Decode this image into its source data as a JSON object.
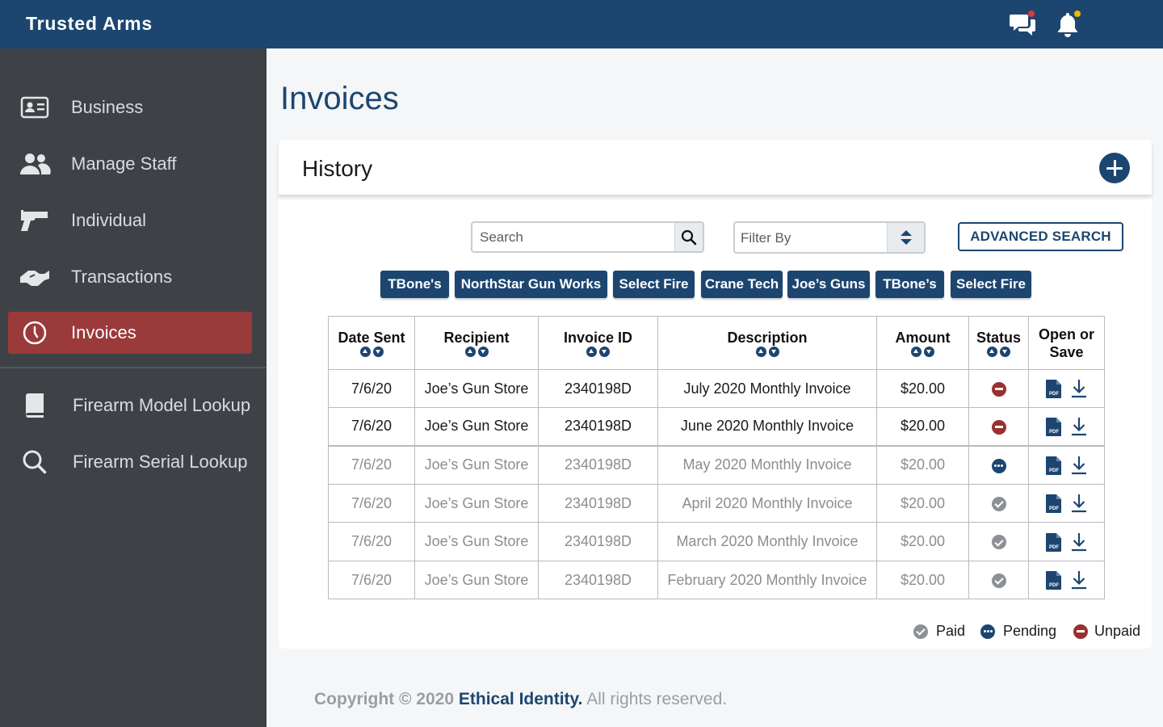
{
  "app": {
    "brand": "Trusted Arms"
  },
  "header": {
    "icons": [
      "chat-icon",
      "bell-icon"
    ]
  },
  "sidebar": {
    "items": [
      {
        "label": "Business",
        "icon": "id-card-icon"
      },
      {
        "label": "Manage Staff",
        "icon": "users-icon"
      },
      {
        "label": "Individual",
        "icon": "pistol-icon"
      },
      {
        "label": "Transactions",
        "icon": "handshake-icon"
      },
      {
        "label": "Invoices",
        "icon": "clock-icon",
        "active": true
      },
      {
        "label": "Firearm Model Lookup",
        "icon": "book-icon"
      },
      {
        "label": "Firearm Serial Lookup",
        "icon": "search-icon"
      }
    ]
  },
  "page": {
    "title": "Invoices"
  },
  "history": {
    "title": "History",
    "search_placeholder": "Search",
    "filter_label": "Filter By",
    "advanced_search": "ADVANCED SEARCH",
    "chips": [
      "TBone's",
      "NorthStar Gun Works",
      "Select Fire",
      "Crane Tech",
      "Joe’s Guns",
      "TBone’s",
      "Select Fire"
    ]
  },
  "table": {
    "headers": {
      "date_sent": "Date Sent",
      "recipient": "Recipient",
      "invoice_id": "Invoice ID",
      "description": "Description",
      "amount": "Amount",
      "status": "Status",
      "open_or": "Open or",
      "save": "Save"
    },
    "rows": [
      {
        "date": "7/6/20",
        "recipient": "Joe’s Gun Store",
        "invoice_id": "2340198D",
        "description": "July 2020 Monthly Invoice",
        "amount": "$20.00",
        "status": "unpaid"
      },
      {
        "date": "7/6/20",
        "recipient": "Joe’s Gun Store",
        "invoice_id": "2340198D",
        "description": "June 2020 Monthly Invoice",
        "amount": "$20.00",
        "status": "unpaid"
      },
      {
        "date": "7/6/20",
        "recipient": "Joe’s Gun Store",
        "invoice_id": "2340198D",
        "description": "May 2020 Monthly Invoice",
        "amount": "$20.00",
        "status": "pending"
      },
      {
        "date": "7/6/20",
        "recipient": "Joe’s Gun Store",
        "invoice_id": "2340198D",
        "description": "April 2020 Monthly Invoice",
        "amount": "$20.00",
        "status": "paid"
      },
      {
        "date": "7/6/20",
        "recipient": "Joe’s Gun Store",
        "invoice_id": "2340198D",
        "description": "March 2020 Monthly Invoice",
        "amount": "$20.00",
        "status": "paid"
      },
      {
        "date": "7/6/20",
        "recipient": "Joe’s Gun Store",
        "invoice_id": "2340198D",
        "description": "February 2020 Monthly Invoice",
        "amount": "$20.00",
        "status": "paid"
      }
    ]
  },
  "legend": {
    "paid": "Paid",
    "pending": "Pending",
    "unpaid": "Unpaid"
  },
  "footer": {
    "copyright": "Copyright",
    "year": "© 2020",
    "company": "Ethical Identity.",
    "rights": "All rights reserved."
  },
  "colors": {
    "brand": "#1c4670",
    "sidebar": "#3e4246",
    "active": "#9a3a3a",
    "unpaid": "#9a2f2f",
    "paid": "#8d9195"
  }
}
